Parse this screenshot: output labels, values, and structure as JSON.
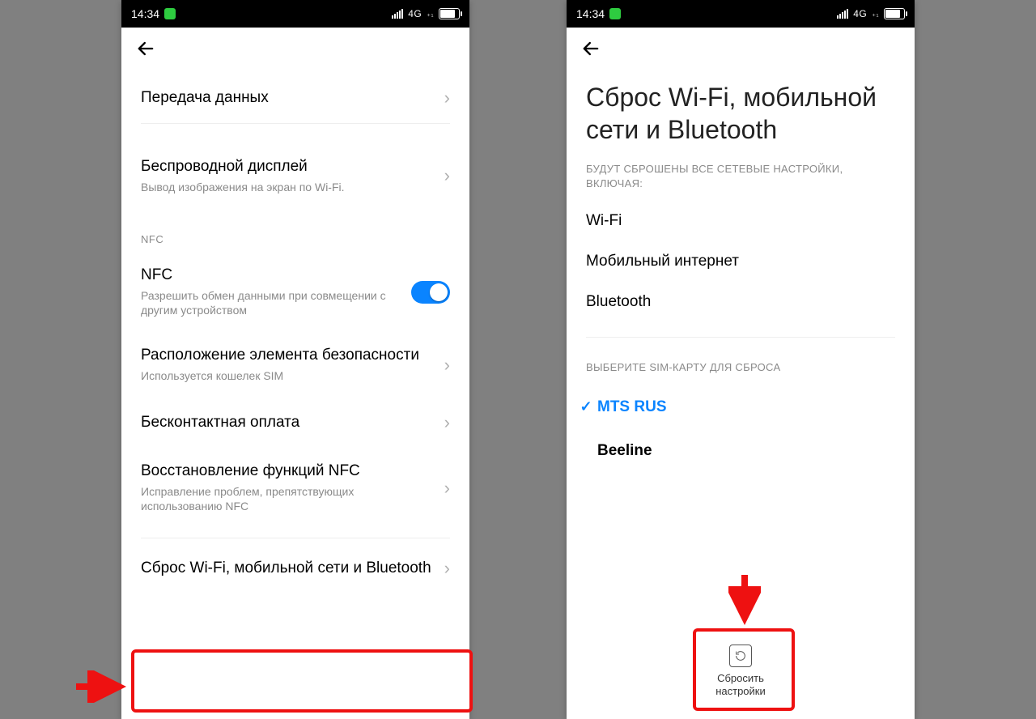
{
  "status": {
    "time": "14:34",
    "network": "4G",
    "network_ext": "₊₁"
  },
  "left": {
    "items": [
      {
        "title": "Передача данных"
      },
      {
        "title": "Беспроводной дисплей",
        "sub": "Вывод изображения на экран по Wi-Fi."
      }
    ],
    "nfc_section_label": "NFC",
    "nfc_item": {
      "title": "NFC",
      "sub": "Разрешить обмен данными при совмещении с другим устройством"
    },
    "secure_elem": {
      "title": "Расположение элемента безопасности",
      "sub": "Используется кошелек SIM"
    },
    "contactless": {
      "title": "Бесконтактная оплата"
    },
    "nfc_restore": {
      "title": "Восстановление функций NFC",
      "sub": "Исправление проблем, препятствующих использованию NFC"
    },
    "reset_item": {
      "title": "Сброс Wi-Fi, мобильной сети и Bluetooth"
    }
  },
  "right": {
    "title": "Сброс Wi-Fi, мобильной сети и Bluetooth",
    "desc": "БУДУТ СБРОШЕНЫ ВСЕ СЕТЕВЫЕ НАСТРОЙКИ, ВКЛЮЧАЯ:",
    "reset_list": [
      "Wi-Fi",
      "Мобильный интернет",
      "Bluetooth"
    ],
    "sim_label": "ВЫБЕРИТЕ SIM-КАРТУ ДЛЯ СБРОСА",
    "sims": [
      {
        "name": "MTS RUS",
        "selected": true
      },
      {
        "name": "Beeline",
        "selected": false
      }
    ],
    "reset_btn": "Сбросить настройки"
  }
}
